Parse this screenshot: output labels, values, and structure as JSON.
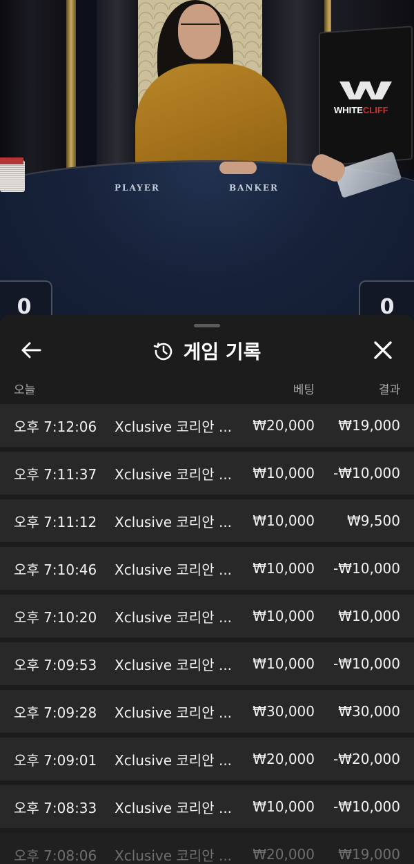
{
  "video": {
    "table_labels": {
      "player": "PLAYER",
      "banker": "BANKER"
    },
    "brand": {
      "name_white": "WHITE",
      "name_red": "CLIFF"
    },
    "scores": {
      "player": "0",
      "banker": "0"
    }
  },
  "sheet": {
    "title": "게임 기록",
    "icons": {
      "back": "arrow-left-icon",
      "history": "history-icon",
      "close": "close-icon"
    },
    "columns": {
      "date": "오늘",
      "bet": "베팅",
      "result": "결과"
    },
    "rows": [
      {
        "time": "오후 7:12:06",
        "game": "Xclusive 코리안 ...",
        "bet": "₩20,000",
        "result": "₩19,000"
      },
      {
        "time": "오후 7:11:37",
        "game": "Xclusive 코리안 ...",
        "bet": "₩10,000",
        "result": "-₩10,000"
      },
      {
        "time": "오후 7:11:12",
        "game": "Xclusive 코리안 ...",
        "bet": "₩10,000",
        "result": "₩9,500"
      },
      {
        "time": "오후 7:10:46",
        "game": "Xclusive 코리안 ...",
        "bet": "₩10,000",
        "result": "-₩10,000"
      },
      {
        "time": "오후 7:10:20",
        "game": "Xclusive 코리안 ...",
        "bet": "₩10,000",
        "result": "₩10,000"
      },
      {
        "time": "오후 7:09:53",
        "game": "Xclusive 코리안 ...",
        "bet": "₩10,000",
        "result": "-₩10,000"
      },
      {
        "time": "오후 7:09:28",
        "game": "Xclusive 코리안 ...",
        "bet": "₩30,000",
        "result": "₩30,000"
      },
      {
        "time": "오후 7:09:01",
        "game": "Xclusive 코리안 ...",
        "bet": "₩20,000",
        "result": "-₩20,000"
      },
      {
        "time": "오후 7:08:33",
        "game": "Xclusive 코리안 ...",
        "bet": "₩10,000",
        "result": "-₩10,000"
      },
      {
        "time": "오후 7:08:06",
        "game": "Xclusive 코리안 ...",
        "bet": "₩20,000",
        "result": "₩19,000"
      }
    ]
  }
}
